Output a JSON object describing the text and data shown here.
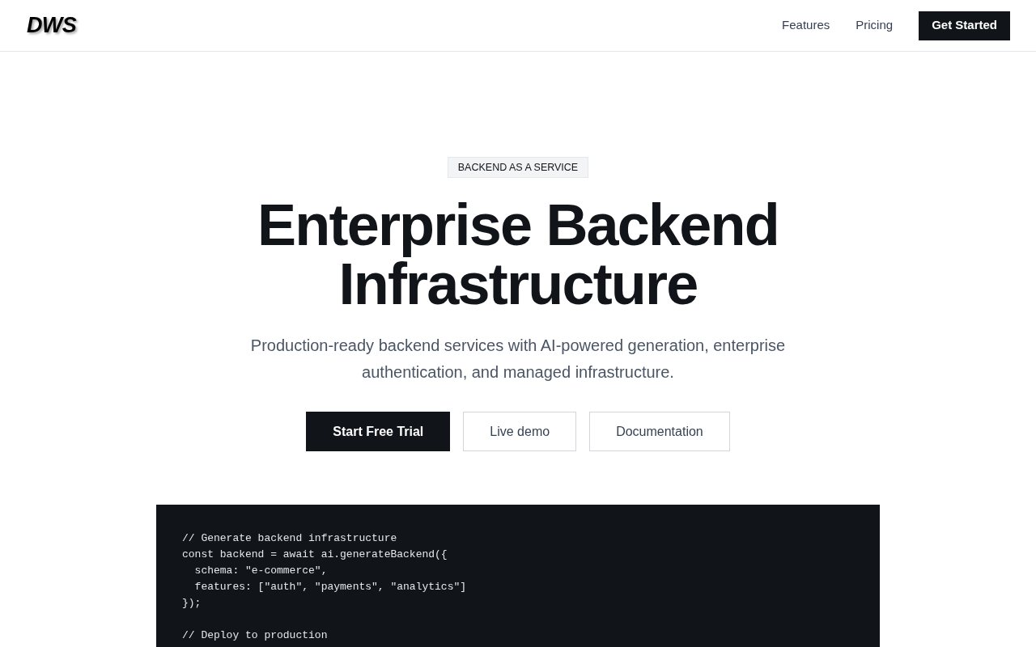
{
  "header": {
    "logo": "DWS",
    "nav_links": [
      "Features",
      "Pricing"
    ],
    "cta": "Get Started"
  },
  "hero": {
    "badge": "BACKEND AS A SERVICE",
    "title": "Enterprise Backend Infrastructure",
    "subtitle": "Production-ready backend services with AI-powered generation, enterprise authentication, and managed infrastructure.",
    "buttons": [
      {
        "label": "Start Free Trial",
        "kind": "primary"
      },
      {
        "label": "Live demo",
        "kind": "outline"
      },
      {
        "label": "Documentation",
        "kind": "outline"
      }
    ]
  },
  "code_block": {
    "code": "// Generate backend infrastructure\nconst backend = await ai.generateBackend({\n  schema: \"e-commerce\",\n  features: [\"auth\", \"payments\", \"analytics\"]\n});\n\n// Deploy to production"
  }
}
